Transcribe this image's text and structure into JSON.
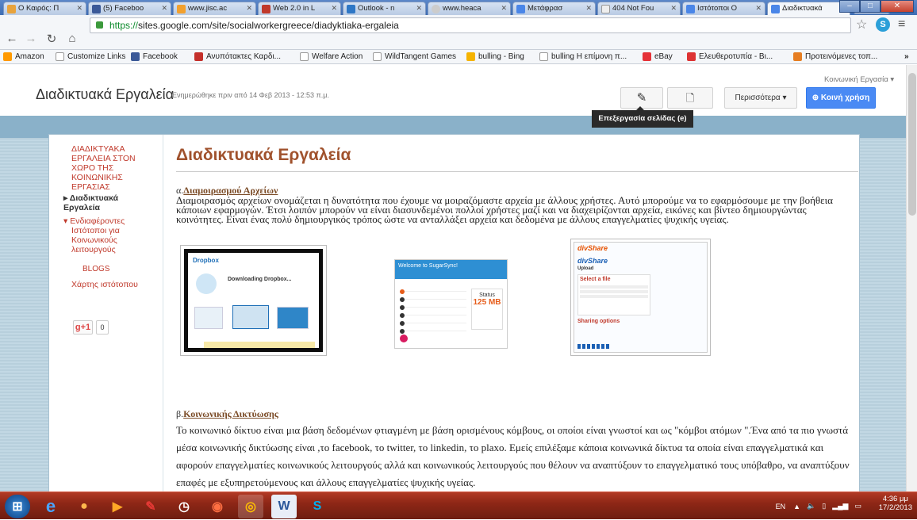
{
  "browser": {
    "tabs": [
      {
        "label": "Ο Καιρός: Π",
        "color": "#e8a33d"
      },
      {
        "label": "(5) Faceboo",
        "color": "#3b5998"
      },
      {
        "label": "www.jisc.ac",
        "color": "#f2a02e"
      },
      {
        "label": "Web 2.0 in L",
        "color": "#c0392b"
      },
      {
        "label": "Outlook - n",
        "color": "#2e77c6"
      },
      {
        "label": "www.heaca",
        "color": "#ccc"
      },
      {
        "label": "Μετάφρασ",
        "color": "#4a86e8"
      },
      {
        "label": "404 Not Fou",
        "color": "#ddd"
      },
      {
        "label": "Ιστότοποι Ο",
        "color": "#4a86e8"
      },
      {
        "label": "Διαδικτυακά",
        "color": "#4a86e8"
      }
    ],
    "url_scheme": "https://",
    "url_rest": "sites.google.com/site/socialworkergreece/diadyktiaka-ergaleia",
    "bookmarks": [
      {
        "label": "Amazon",
        "color": "#f90"
      },
      {
        "label": "Customize Links",
        "color": "#ddd"
      },
      {
        "label": "Facebook",
        "color": "#3b5998"
      },
      {
        "label": "Ανυπότακτες Καρδι...",
        "color": "#c4302b"
      },
      {
        "label": "Welfare Action",
        "color": "#ddd"
      },
      {
        "label": "WildTangent Games",
        "color": "#ddd"
      },
      {
        "label": "bulling - Bing",
        "color": "#f5b300"
      },
      {
        "label": "bulling Η επίμονη π...",
        "color": "#ddd"
      },
      {
        "label": "eBay",
        "color": "#e53238"
      },
      {
        "label": "Ελευθεροτυπία - Βι...",
        "color": "#d33"
      },
      {
        "label": "Προτεινόμενες τοπ...",
        "color": "#e67e22"
      }
    ],
    "overflow": "»"
  },
  "site": {
    "title": "Διαδικτυακά Εργαλεία",
    "updated": "Ενημερώθηκε πριν από 14 Φεβ 2013 - 12:53 π.μ.",
    "subtitle": "Κοινωνική Εργασία ▾",
    "more_label": "Περισσότερα ▾",
    "share_label": "Κοινή χρήση",
    "tooltip": "Επεξεργασία σελίδας (e)"
  },
  "sidebar": {
    "items": [
      "ΔΙΑΔΙΚΤΥΑΚΑ",
      "ΕΡΓΑΛΕΙΑ ΣΤΟΝ",
      "ΧΩΡΟ ΤΗΣ",
      "ΚΟΙΝΩΝΙΚΗΣ",
      "ΕΡΓΑΣΙΑΣ"
    ],
    "current_1": "▸ Διαδικτυακά",
    "current_2": "Εργαλεία",
    "interest_1": "▾ Ενδιαφέροντες",
    "interest_2": "Ιστότοποι για",
    "interest_3": "Κοινωνικούς",
    "interest_4": "λειτουργούς",
    "blogs": "BLOGS",
    "sitemap": "Χάρτης ιστότοπου",
    "plus1_label": "+1",
    "plus1_count": "0"
  },
  "main": {
    "heading": "Διαδικτυακά Εργαλεία",
    "sec_a_prefix": "α.",
    "sec_a_title": "Διαμοιρασμού Αρχείων",
    "para_a": "Διαμοιρασμός αρχείων ονομάζεται η δυνατότητα που έχουμε να μοιραζόμαστε αρχεία με άλλους χρήστες. Αυτό μπορούμε να το εφαρμόσουμε με την βοήθεια κάποιων εφαρμογών. Έτσι λοιπόν μπορούν να είναι διασυνδεμένοι πολλοί χρήστες μαζί και να διαχειρίζονται αρχεία, εικόνες και βίντεο δημιουργώντας κοινότητες. Είναι ένας πολύ δημιουργικός τρόπος ώστε να ανταλλάξει αρχεία και δεδομένα με άλλους επαγγελματίες ψυχικής υγείας.",
    "shot1_title": "Dropbox",
    "shot1_text": "Downloading Dropbox...",
    "shot2_title": "Welcome to SugarSync!",
    "shot2_status": "Status",
    "shot2_mb": "125 MB",
    "shot3_title": "divShare",
    "shot3_upload": "Upload",
    "shot3_select": "Select a file",
    "shot3_sharing": "Sharing options",
    "sec_b_prefix": "β.",
    "sec_b_title": "Κοινωνικής Δικτύωσης",
    "para_b": "Το κοινωνικό δίκτυο είναι μια βάση δεδομένων φτιαγμένη με βάση ορισμένους κόμβους, οι οποίοι είναι γνωστοί και ως \"κόμβοι ατόμων \".Ένα από τα πιο γνωστά μέσα κοινωνικής δικτύωσης είναι ,το facebook, το twitter, το linkedin, το plaxo. Εμείς επιλέξαμε κάποια κοινωνικά δίκτυα τα οποία είναι  επαγγελματικά και αφορούν επαγγελματίες κοινωνικούς λειτουργούς αλλά και κοινωνικούς λειτουργούς που θέλουν να αναπτύξουν το επαγγελματικό τους υπόβαθρο, να αναπτύξουν επαφές  με εξυπηρετούμενους και άλλους επαγγελματίες ψυχικής υγείας."
  },
  "taskbar": {
    "lang": "EN",
    "time": "4:36 μμ",
    "date": "17/2/2013"
  }
}
